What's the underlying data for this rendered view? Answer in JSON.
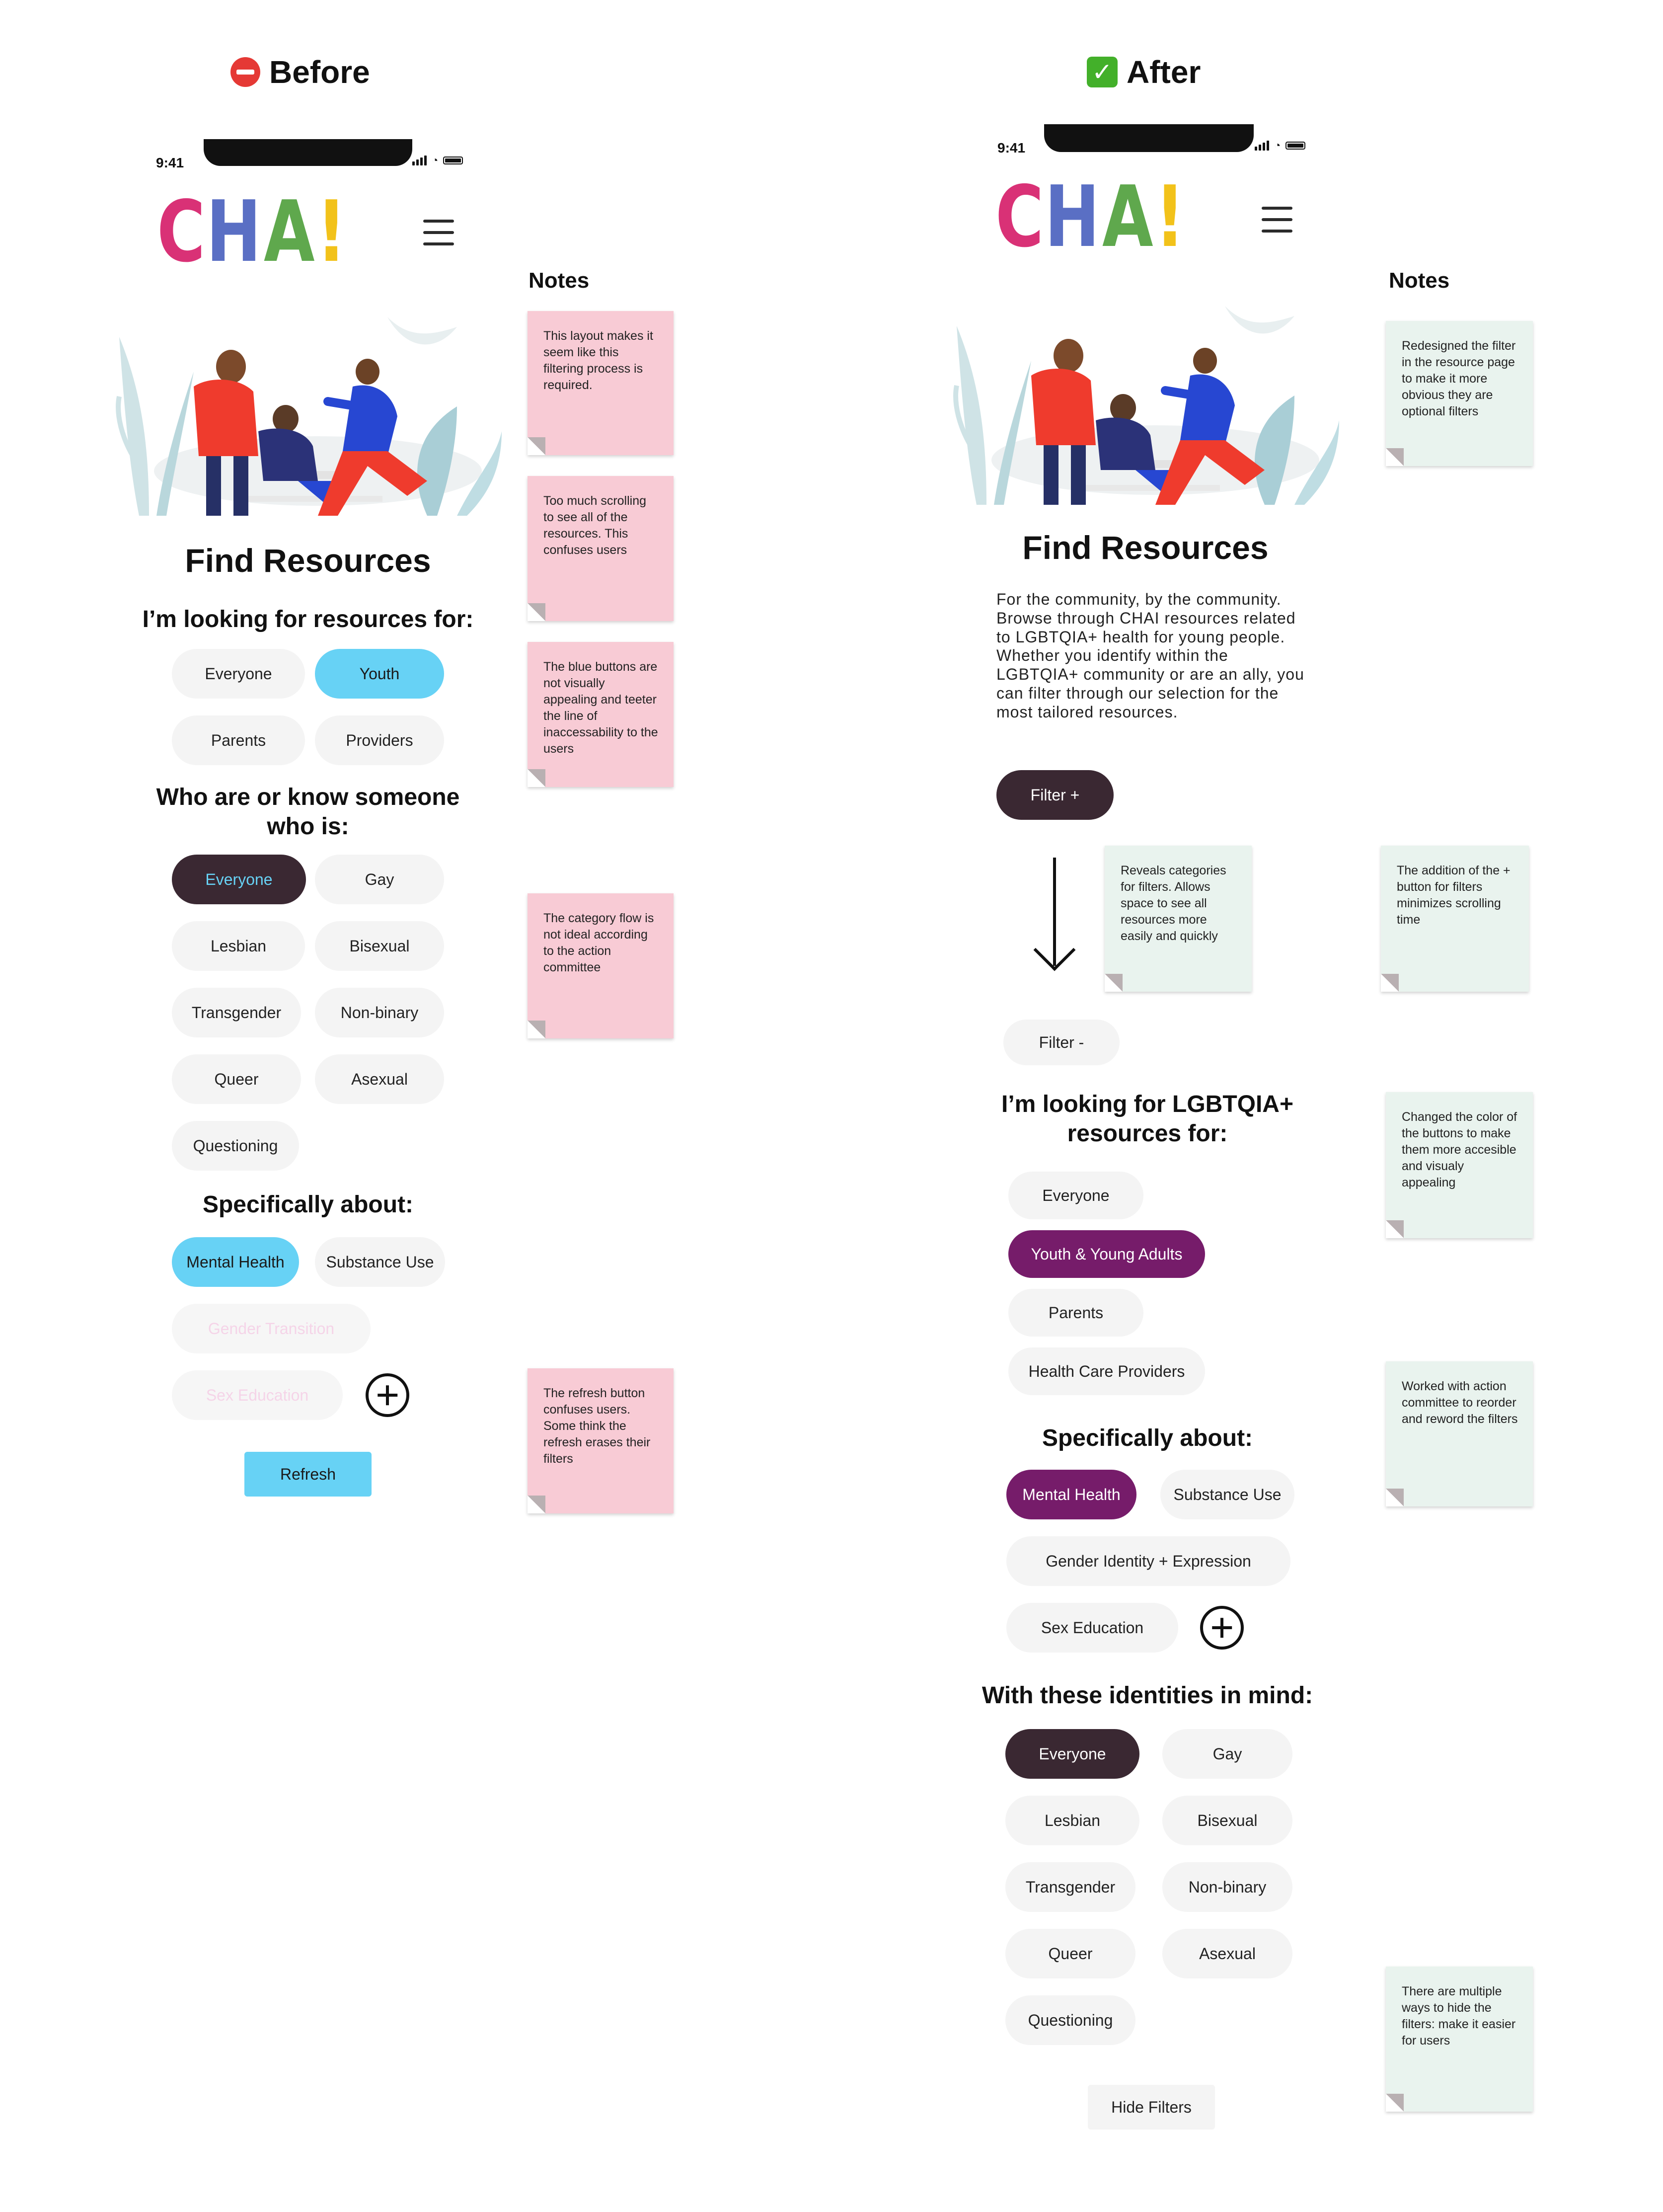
{
  "before": {
    "heading": "Before",
    "status_time": "9:41",
    "logo": [
      "C",
      "H",
      "A",
      "!"
    ],
    "title": "Find Resources",
    "for_label": "I’m looking for resources for:",
    "audience": [
      "Everyone",
      "Youth",
      "Parents",
      "Providers"
    ],
    "who_label": "Who are or know someone who is:",
    "identities": [
      "Everyone",
      "Gay",
      "Lesbian",
      "Bisexual",
      "Transgender",
      "Non-binary",
      "Queer",
      "Asexual",
      "Questioning"
    ],
    "about_label": "Specifically about:",
    "topics": [
      "Mental Health",
      "Substance Use",
      "Gender Transition",
      "Sex Education"
    ],
    "refresh_label": "Refresh",
    "notes_label": "Notes",
    "notes": [
      "This layout makes it seem like this filtering process is required.",
      "Too much scrolling to see all of the resources. This confuses users",
      "The blue buttons are not visually appealing and teeter the line of inaccessability to the users",
      "The category flow is not ideal according to the action committee",
      "The refresh button confuses users. Some think the refresh erases their filters"
    ]
  },
  "after": {
    "heading": "After",
    "status_time": "9:41",
    "logo": [
      "C",
      "H",
      "A",
      "!"
    ],
    "title": "Find Resources",
    "intro": "For the community, by the community. Browse through CHAI resources related to LGBTQIA+ health for young people. Whether you identify within the LGBTQIA+ community or are an ally, you can filter through our selection for the most tailored resources.",
    "filter_open_label": "Filter +",
    "filter_close_label": "Filter -",
    "for_label": "I’m looking for LGBTQIA+ resources for:",
    "audience": [
      "Everyone",
      "Youth & Young Adults",
      "Parents",
      "Health Care Providers"
    ],
    "about_label": "Specifically about:",
    "topics": [
      "Mental Health",
      "Substance Use",
      "Gender Identity + Expression",
      "Sex Education"
    ],
    "identities_label": "With these identities in mind:",
    "identities": [
      "Everyone",
      "Gay",
      "Lesbian",
      "Bisexual",
      "Transgender",
      "Non-binary",
      "Queer",
      "Asexual",
      "Questioning"
    ],
    "hide_label": "Hide Filters",
    "notes_label": "Notes",
    "notes": [
      "Redesigned the filter in the resource page to make it more obvious they are optional filters",
      "Reveals categories for filters. Allows space to see all resources more easily and quickly",
      "The addition of the + button for filters minimizes scrolling time",
      "Changed the color of the buttons to make them more accesible and visualy appealing",
      "Worked with action committee to reorder and reword the filters",
      "There are multiple ways to hide the filters: make it easier for users"
    ]
  },
  "colors": {
    "logo_c": "#d93176",
    "logo_h": "#5a6fc4",
    "logo_a": "#5fa84d",
    "logo_bang": "#f2c21a",
    "cyan": "#67d2f5",
    "dark": "#3a2832",
    "purple": "#761c6a",
    "note_pink": "#f8cbd5",
    "note_mint": "#e9f3ee"
  },
  "icons": {
    "before_heading": "no-entry-icon",
    "after_heading": "check-mark-icon",
    "menu": "hamburger-menu-icon",
    "add": "plus-circle-icon",
    "arrow": "down-arrow-icon"
  }
}
